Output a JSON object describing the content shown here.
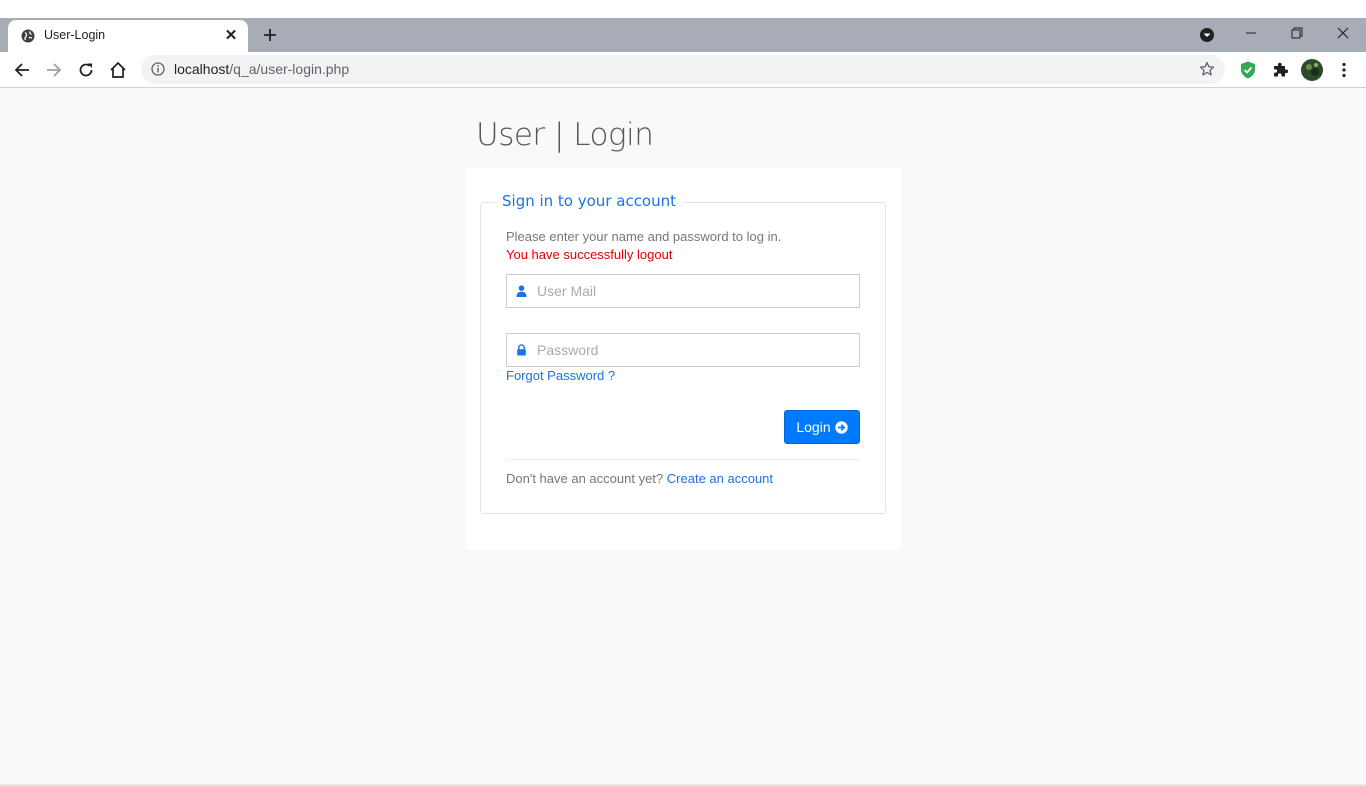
{
  "browser": {
    "tab_title": "User-Login",
    "url_host": "localhost",
    "url_path": "/q_a/user-login.php"
  },
  "page": {
    "title": "User | Login",
    "legend": "Sign in to your account",
    "help_text": "Please enter your name and password to log in.",
    "status_message": "You have successfully logout",
    "status_color": "#e00000",
    "email_placeholder": "User Mail",
    "password_placeholder": "Password",
    "forgot_link": "Forgot Password ?",
    "login_label": "Login",
    "signup_prompt": "Don't have an account yet?",
    "signup_link": "Create an account",
    "accent_color": "#007bff"
  }
}
